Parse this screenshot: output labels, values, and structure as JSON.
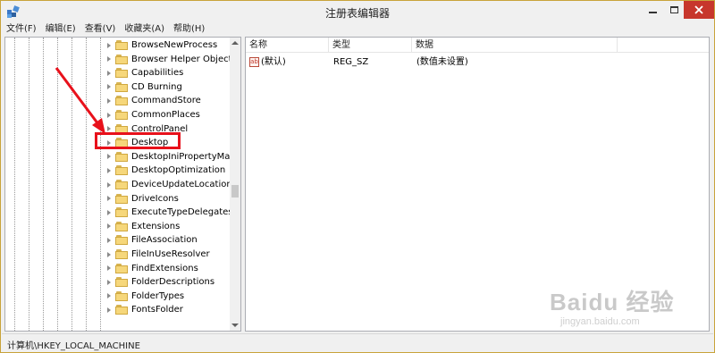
{
  "window": {
    "title": "注册表编辑器",
    "menus": [
      "文件(F)",
      "编辑(E)",
      "查看(V)",
      "收藏夹(A)",
      "帮助(H)"
    ]
  },
  "tree": {
    "items": [
      {
        "label": "BrowseNewProcess"
      },
      {
        "label": "Browser Helper Objects"
      },
      {
        "label": "Capabilities"
      },
      {
        "label": "CD Burning"
      },
      {
        "label": "CommandStore"
      },
      {
        "label": "CommonPlaces"
      },
      {
        "label": "ControlPanel"
      },
      {
        "label": "Desktop"
      },
      {
        "label": "DesktopIniPropertyMap"
      },
      {
        "label": "DesktopOptimization"
      },
      {
        "label": "DeviceUpdateLocations"
      },
      {
        "label": "DriveIcons"
      },
      {
        "label": "ExecuteTypeDelegates"
      },
      {
        "label": "Extensions"
      },
      {
        "label": "FileAssociation"
      },
      {
        "label": "FileInUseResolver"
      },
      {
        "label": "FindExtensions"
      },
      {
        "label": "FolderDescriptions"
      },
      {
        "label": "FolderTypes"
      },
      {
        "label": "FontsFolder"
      }
    ],
    "highlighted": "Desktop"
  },
  "list": {
    "columns": [
      "名称",
      "类型",
      "数据"
    ],
    "rows": [
      {
        "name": "(默认)",
        "type": "REG_SZ",
        "data": "(数值未设置)",
        "icon": "ab"
      }
    ]
  },
  "status": {
    "path": "计算机\\HKEY_LOCAL_MACHINE"
  },
  "watermark": {
    "main": "Baidu 经验",
    "sub": "jingyan.baidu.com"
  },
  "colors": {
    "highlight": "#e8111b",
    "close_button": "#c7362c"
  }
}
